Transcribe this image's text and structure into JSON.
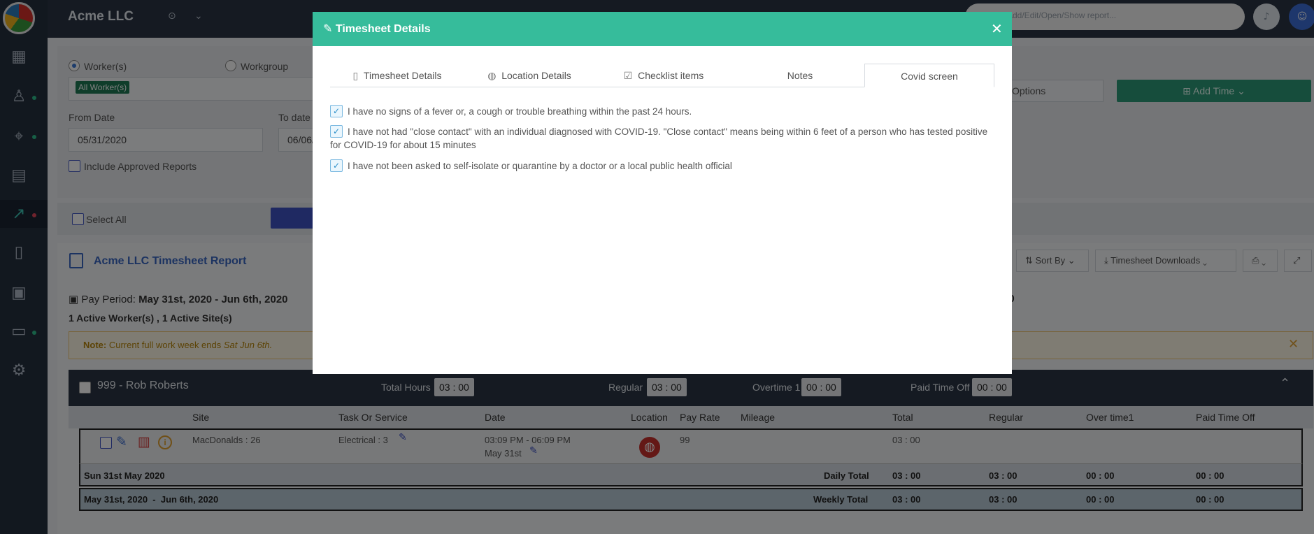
{
  "app": {
    "company": "Acme LLC",
    "search_placeholder": "Add/Edit/Open/Show report..."
  },
  "colors": {
    "accent": "#36bc9b",
    "dark": "#2a3444",
    "link": "#3866c2",
    "add_time": "#2c9a78"
  },
  "sidebar": {
    "items": [
      {
        "icon": "dashboard-chart-icon",
        "dot": false
      },
      {
        "icon": "users-icon",
        "dot": true
      },
      {
        "icon": "location-pin-icon",
        "dot": true
      },
      {
        "icon": "clipboard-icon",
        "dot": false
      },
      {
        "icon": "trend-chart-icon",
        "dot": true,
        "active": true
      },
      {
        "icon": "document-icon",
        "dot": false
      },
      {
        "icon": "calendar-icon",
        "dot": false
      },
      {
        "icon": "chat-icon",
        "dot": true
      },
      {
        "icon": "settings-gear-icon",
        "dot": false
      }
    ]
  },
  "filters": {
    "worker_label": "Worker(s)",
    "workgroup_label": "Workgroup",
    "selected_chip": "All Worker(s)",
    "from_date_label": "From Date",
    "from_date_value": "05/31/2020",
    "to_date_label": "To date",
    "to_date_value": "06/06/",
    "include_approved": "Include Approved Reports",
    "options_label": "Options",
    "add_time_label": "Add Time"
  },
  "select_all_label": "Select All",
  "report": {
    "title": "Acme LLC Timesheet Report",
    "sort_by": "Sort By",
    "downloads": "Timesheet Downloads",
    "pay_period_label": "Pay Period:",
    "pay_period_value": "May 31st, 2020 - Jun 6th, 2020",
    "active_summary": "1 Active Worker(s) , 1 Active Site(s)",
    "right_total": "00",
    "note_label": "Note:",
    "note_text": "Current full work week ends",
    "note_date": "Sat Jun 6th."
  },
  "employee": {
    "name": "999 - Rob Roberts",
    "total_hours_label": "Total Hours",
    "total_hours": "03 : 00",
    "regular_label": "Regular",
    "regular": "03 : 00",
    "overtime_label": "Overtime 1",
    "overtime": "00 : 00",
    "pto_label": "Paid Time Off",
    "pto": "00 : 00"
  },
  "table": {
    "headers": [
      "Site",
      "Task Or Service",
      "Date",
      "Location",
      "Pay Rate",
      "Mileage",
      "Total",
      "Regular",
      "Over time1",
      "Paid Time Off"
    ],
    "entry": {
      "site": "MacDonalds : 26",
      "task": "Electrical : 3",
      "time_range": "03:09 PM - 06:09 PM",
      "date": "May 31st",
      "pay_rate": "99",
      "total": "03 : 00"
    },
    "daily": {
      "label": "Sun 31st May 2020",
      "total_label": "Daily Total",
      "total": "03 : 00",
      "regular": "03 : 00",
      "overtime": "00 : 00",
      "pto": "00 : 00"
    },
    "weekly": {
      "label": "May 31st, 2020  -  Jun 6th, 2020",
      "total_label": "Weekly Total",
      "total": "03 : 00",
      "regular": "03 : 00",
      "overtime": "00 : 00",
      "pto": "00 : 00"
    }
  },
  "modal": {
    "title": "Timesheet Details",
    "tabs": [
      {
        "label": "Timesheet Details",
        "icon": "document-icon"
      },
      {
        "label": "Location Details",
        "icon": "globe-icon"
      },
      {
        "label": "Checklist items",
        "icon": "checkbox-icon"
      },
      {
        "label": "Notes",
        "icon": ""
      },
      {
        "label": "Covid screen",
        "icon": "",
        "active": true
      }
    ],
    "covid_items": [
      "I have no signs of a fever or, a cough or trouble breathing within the past 24 hours.",
      "I have not had \"close contact\" with an individual diagnosed with COVID-19. \"Close contact\" means being within 6 feet of a person who has tested positive for COVID-19 for about 15 minutes",
      "I have not been asked to self-isolate or quarantine by a doctor or a local public health official"
    ]
  }
}
